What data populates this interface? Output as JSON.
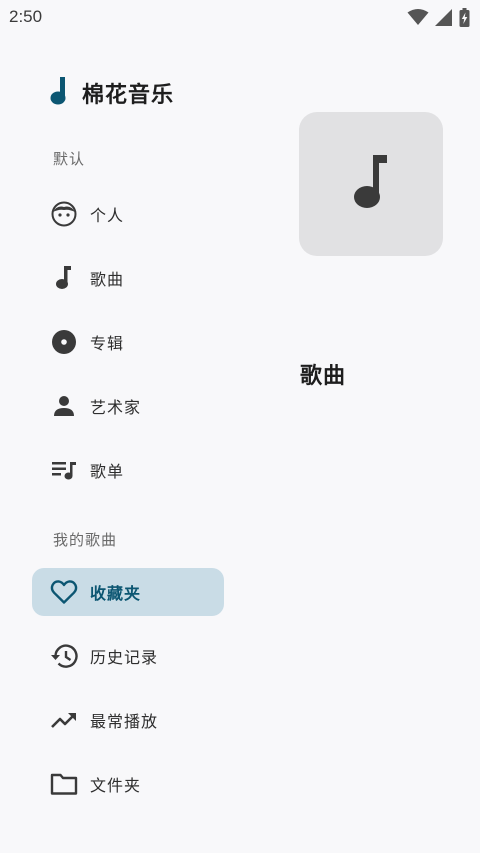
{
  "status_bar": {
    "time": "2:50",
    "icons": [
      "wifi-icon",
      "cellular-signal-icon",
      "battery-charging-icon"
    ]
  },
  "brand": {
    "app_name": "棉花音乐",
    "logo_icon": "music-note-icon",
    "accent_color": "#0c5672"
  },
  "sections": {
    "default_label": "默认",
    "my_music_label": "我的歌曲"
  },
  "nav": {
    "personal": {
      "label": "个人",
      "icon": "face-icon"
    },
    "songs": {
      "label": "歌曲",
      "icon": "music-note-icon"
    },
    "albums": {
      "label": "专辑",
      "icon": "album-disc-icon"
    },
    "artists": {
      "label": "艺术家",
      "icon": "person-icon"
    },
    "playlists": {
      "label": "歌单",
      "icon": "playlist-icon"
    },
    "favorites": {
      "label": "收藏夹",
      "icon": "heart-outline-icon",
      "active": true
    },
    "history": {
      "label": "历史记录",
      "icon": "history-icon"
    },
    "most_played": {
      "label": "最常播放",
      "icon": "trending-up-icon"
    },
    "folders": {
      "label": "文件夹",
      "icon": "folder-outline-icon"
    }
  },
  "detail": {
    "title": "歌曲",
    "art_icon": "music-note-icon"
  },
  "colors": {
    "background": "#f8f8fa",
    "active_bg": "#c9dce6",
    "art_bg": "#e1e1e3",
    "icon": "#3a3a3a"
  }
}
